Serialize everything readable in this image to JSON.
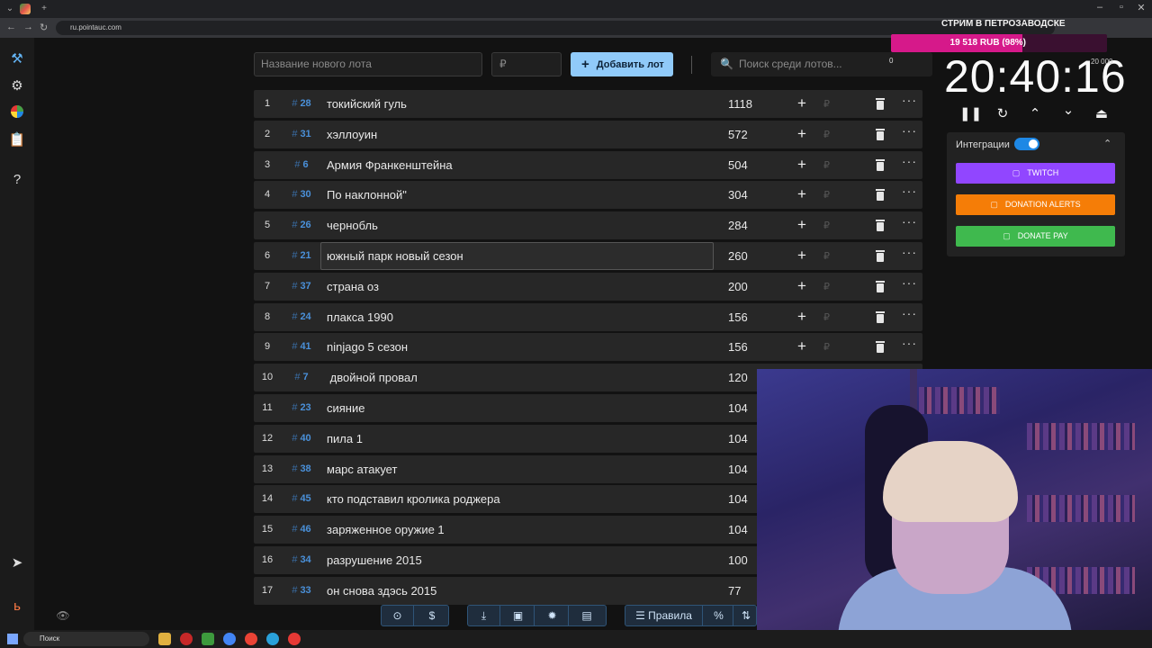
{
  "browser": {
    "url": "ru.pointauc.com",
    "new_tab": "+"
  },
  "toolbar": {
    "lot_name_placeholder": "Название нового лота",
    "price_placeholder": "₽",
    "add_label": "Добавить лот",
    "search_placeholder": "Поиск среди лотов...",
    "search_count": "0"
  },
  "lots": [
    {
      "num": "1",
      "id": "28",
      "name": "токийский гуль",
      "amount": "1118"
    },
    {
      "num": "2",
      "id": "31",
      "name": "хэллоуин",
      "amount": "572"
    },
    {
      "num": "3",
      "id": "6",
      "name": "Армия Франкенштейна",
      "amount": "504"
    },
    {
      "num": "4",
      "id": "30",
      "name": "По наклонной\"",
      "amount": "304"
    },
    {
      "num": "5",
      "id": "26",
      "name": "чернобль",
      "amount": "284"
    },
    {
      "num": "6",
      "id": "21",
      "name": "южный парк новый сезон",
      "amount": "260"
    },
    {
      "num": "7",
      "id": "37",
      "name": "страна оз",
      "amount": "200"
    },
    {
      "num": "8",
      "id": "24",
      "name": "плакса 1990",
      "amount": "156"
    },
    {
      "num": "9",
      "id": "41",
      "name": "ninjago 5 сезон",
      "amount": "156"
    },
    {
      "num": "10",
      "id": "7",
      "name": " двойной провал",
      "amount": "120"
    },
    {
      "num": "11",
      "id": "23",
      "name": "сияние",
      "amount": "104"
    },
    {
      "num": "12",
      "id": "40",
      "name": "пила 1",
      "amount": "104"
    },
    {
      "num": "13",
      "id": "38",
      "name": "марс атакует",
      "amount": "104"
    },
    {
      "num": "14",
      "id": "45",
      "name": "кто подставил кролика роджера",
      "amount": "104"
    },
    {
      "num": "15",
      "id": "46",
      "name": "заряженное оружие 1",
      "amount": "104"
    },
    {
      "num": "16",
      "id": "34",
      "name": "разрушение 2015",
      "amount": "100"
    },
    {
      "num": "17",
      "id": "33",
      "name": "он снова здэсь 2015",
      "amount": "77"
    }
  ],
  "row_symbols": {
    "hash": "#",
    "rub": "₽",
    "plus": "+",
    "more": "···"
  },
  "bottom_bar": {
    "rules_label": "Правила",
    "percent_label": "%"
  },
  "stream": {
    "title": "СТРИМ В ПЕТРОЗАВОДСКЕ",
    "progress_text": "19 518 RUB (98%)",
    "progress_fraction": 0.98,
    "timer": "20:40:16",
    "timer_sub": "20 000"
  },
  "integrations": {
    "label": "Интеграции",
    "enabled": true,
    "services": [
      {
        "label": "TWITCH",
        "color": "#9146ff"
      },
      {
        "label": "DONATION ALERTS",
        "color": "#f57d07"
      },
      {
        "label": "DONATE PAY",
        "color": "#3fb94e"
      }
    ]
  },
  "taskbar": {
    "search_label": "Поиск"
  },
  "colors": {
    "accent": "#90caf9",
    "lot_id": "#4a90d9",
    "progress": "#d6198a"
  }
}
